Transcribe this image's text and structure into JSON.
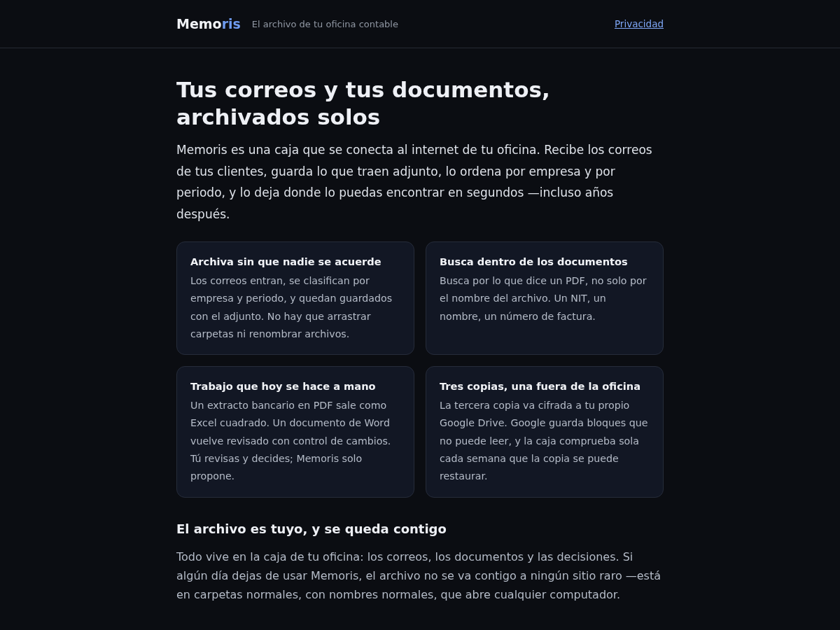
{
  "header": {
    "logo_main": "Memo",
    "logo_accent": "ris",
    "tagline": "El archivo de tu oficina contable",
    "link": "Privacidad"
  },
  "hero": {
    "title": "Tus correos y tus documentos, archivados solos",
    "lead": "Memoris es una caja que se conecta al internet de tu oficina. Recibe los correos de tus clientes, guarda lo que traen adjunto, lo ordena por empresa y por periodo, y lo deja donde lo puedas encontrar en segundos —incluso años después."
  },
  "cards": [
    {
      "title": "Archiva sin que nadie se acuerde",
      "text": "Los correos entran, se clasifican por empresa y periodo, y quedan guardados con el adjunto. No hay que arrastrar carpetas ni renombrar archivos."
    },
    {
      "title": "Busca dentro de los documentos",
      "text": "Busca por lo que dice un PDF, no solo por el nombre del archivo. Un NIT, un nombre, un número de factura."
    },
    {
      "title": "Trabajo que hoy se hace a mano",
      "text": "Un extracto bancario en PDF sale como Excel cuadrado. Un documento de Word vuelve revisado con control de cambios. Tú revisas y decides; Memoris solo propone."
    },
    {
      "title": "Tres copias, una fuera de la oficina",
      "text": "La tercera copia va cifrada a tu propio Google Drive. Google guarda bloques que no puede leer, y la caja comprueba sola cada semana que la copia se puede restaurar."
    }
  ],
  "section": {
    "heading": "El archivo es tuyo, y se queda contigo",
    "text": "Todo vive en la caja de tu oficina: los correos, los documentos y las decisiones. Si algún día dejas de usar Memoris, el archivo no se va contigo a ningún sitio raro —está en carpetas normales, con nombres normales, que abre cualquier computador."
  }
}
